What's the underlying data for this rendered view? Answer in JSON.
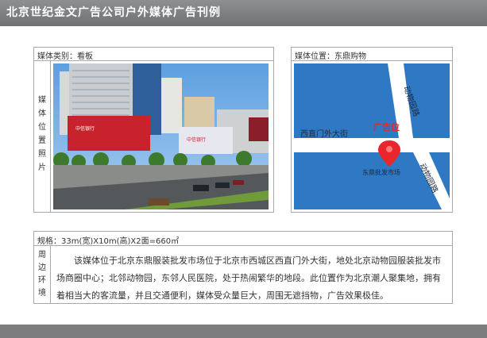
{
  "header": {
    "title": "北京世纪金文广告公司户外媒体广告刊例"
  },
  "media_type": {
    "label": "媒体类别：看板"
  },
  "media_location": {
    "label": "媒体位置：东鼎购物"
  },
  "photo_caption": [
    "媒",
    "体",
    "位",
    "置",
    "照",
    "片"
  ],
  "map": {
    "road_top": "动物园路",
    "road_bottom": "动物园路",
    "street": "西直门外大街",
    "marker": "广告位",
    "place": "东鼎批发市场"
  },
  "spec": {
    "text": "规格：33m(宽)X10m(高)X2面=660㎡"
  },
  "surroundings_label": [
    "周",
    "边",
    "环",
    "境"
  ],
  "description": "该媒体位于北京东鼎服装批发市场位于北京市西城区西直门外大街，地处北京动物园服装批发市场商圈中心；北邻动物园，东邻人民医院，处于热闹繁华的地段。此位置作为北京潮人聚集地，拥有着相当大的客流量，并且交通便利，媒体受众量巨大，周围无遮挡物，广告效果极佳。",
  "billboards": {
    "left_brand": "中信银行",
    "right_brand": "中信银行"
  },
  "colors": {
    "header": "#7a7c7e",
    "map_water": "#2f79c4",
    "marker": "#e8262b",
    "road": "#ffffff"
  }
}
